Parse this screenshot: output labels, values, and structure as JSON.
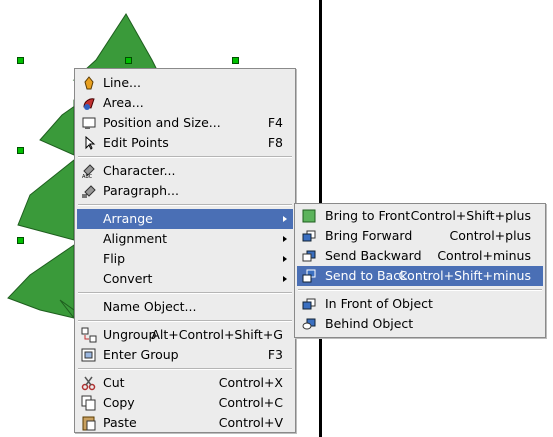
{
  "colors": {
    "highlight": "#4a6fb5",
    "menu_bg": "#ececec",
    "tree": "#3a9a3a",
    "handle": "#00c000"
  },
  "context_menu": {
    "items": [
      {
        "label": "Line...",
        "shortcut": "",
        "icon": "line-icon"
      },
      {
        "label": "Area...",
        "shortcut": "",
        "icon": "area-icon"
      },
      {
        "label": "Position and Size...",
        "shortcut": "F4",
        "icon": "position-size-icon"
      },
      {
        "label": "Edit Points",
        "shortcut": "F8",
        "icon": "edit-points-icon"
      },
      {
        "label": "Character...",
        "shortcut": "",
        "icon": "character-icon"
      },
      {
        "label": "Paragraph...",
        "shortcut": "",
        "icon": "paragraph-icon"
      },
      {
        "label": "Arrange",
        "shortcut": "",
        "submenu": true,
        "active": true
      },
      {
        "label": "Alignment",
        "shortcut": "",
        "submenu": true
      },
      {
        "label": "Flip",
        "shortcut": "",
        "submenu": true
      },
      {
        "label": "Convert",
        "shortcut": "",
        "submenu": true
      },
      {
        "label": "Name Object...",
        "shortcut": ""
      },
      {
        "label": "Ungroup",
        "shortcut": "Alt+Control+Shift+G",
        "icon": "ungroup-icon"
      },
      {
        "label": "Enter Group",
        "shortcut": "F3",
        "icon": "enter-group-icon"
      },
      {
        "label": "Cut",
        "shortcut": "Control+X",
        "icon": "cut-icon"
      },
      {
        "label": "Copy",
        "shortcut": "Control+C",
        "icon": "copy-icon"
      },
      {
        "label": "Paste",
        "shortcut": "Control+V",
        "icon": "paste-icon"
      }
    ]
  },
  "arrange_submenu": {
    "items": [
      {
        "label": "Bring to Front",
        "shortcut": "Control+Shift+plus",
        "icon": "bring-to-front-icon"
      },
      {
        "label": "Bring Forward",
        "shortcut": "Control+plus",
        "icon": "bring-forward-icon"
      },
      {
        "label": "Send Backward",
        "shortcut": "Control+minus",
        "icon": "send-backward-icon"
      },
      {
        "label": "Send to Back",
        "shortcut": "Control+Shift+minus",
        "icon": "send-to-back-icon",
        "active": true
      },
      {
        "label": "In Front of Object",
        "shortcut": "",
        "icon": "in-front-of-object-icon"
      },
      {
        "label": "Behind Object",
        "shortcut": "",
        "icon": "behind-object-icon"
      }
    ]
  }
}
